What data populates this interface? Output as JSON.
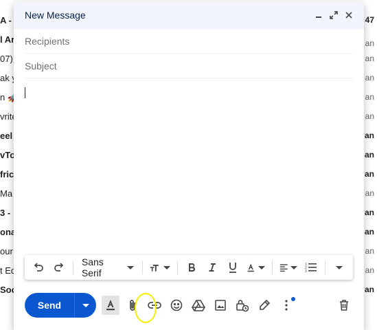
{
  "background": {
    "left_fragments": [
      {
        "text": "A -",
        "bold": true
      },
      {
        "text": "l Ar",
        "bold": true
      },
      {
        "text": "07)",
        "bold": false
      },
      {
        "text": "ak y",
        "bold": false
      },
      {
        "text": "n 🚀",
        "bold": false
      },
      {
        "text": "vrite",
        "bold": false
      },
      {
        "text": "eel",
        "bold": true
      },
      {
        "text": "vTo",
        "bold": true
      },
      {
        "text": "fric",
        "bold": true
      },
      {
        "text": " Ma",
        "bold": false
      },
      {
        "text": "3 -",
        "bold": true
      },
      {
        "text": "onal",
        "bold": true
      },
      {
        "text": "our",
        "bold": false
      },
      {
        "text": "t Ed",
        "bold": false
      },
      {
        "text": "Soc",
        "bold": true
      }
    ],
    "right_fragments": [
      {
        "text": "47",
        "bold": true
      },
      {
        "text": "an",
        "bold": false
      },
      {
        "text": "an",
        "bold": false
      },
      {
        "text": "an",
        "bold": false
      },
      {
        "text": "an",
        "bold": false
      },
      {
        "text": "an",
        "bold": false
      },
      {
        "text": "an",
        "bold": true
      },
      {
        "text": "an",
        "bold": true
      },
      {
        "text": "an",
        "bold": true
      },
      {
        "text": "an",
        "bold": false
      },
      {
        "text": "an",
        "bold": true
      },
      {
        "text": "an",
        "bold": true
      },
      {
        "text": "an",
        "bold": false
      },
      {
        "text": "an",
        "bold": false
      },
      {
        "text": "an",
        "bold": true
      }
    ]
  },
  "compose": {
    "title": "New Message",
    "recipients_placeholder": "Recipients",
    "subject_placeholder": "Subject",
    "font_family": "Sans Serif",
    "send_label": "Send"
  },
  "colors": {
    "accent": "#0b57d0",
    "title_bar": "#f2f6fc",
    "highlight_circle": "#f5f000"
  },
  "icons": {
    "titlebar": [
      "minimize-icon",
      "expand-icon",
      "close-icon"
    ],
    "format": [
      "undo-icon",
      "redo-icon",
      "text-size-icon",
      "bold-icon",
      "italic-icon",
      "underline-icon",
      "text-color-icon",
      "align-icon",
      "numbered-list-icon",
      "more-formatting-icon"
    ],
    "bottom": [
      "formatting-toggle-icon",
      "attach-icon",
      "link-icon",
      "emoji-icon",
      "drive-icon",
      "photo-icon",
      "confidential-icon",
      "signature-icon",
      "more-options-icon",
      "trash-icon"
    ]
  }
}
